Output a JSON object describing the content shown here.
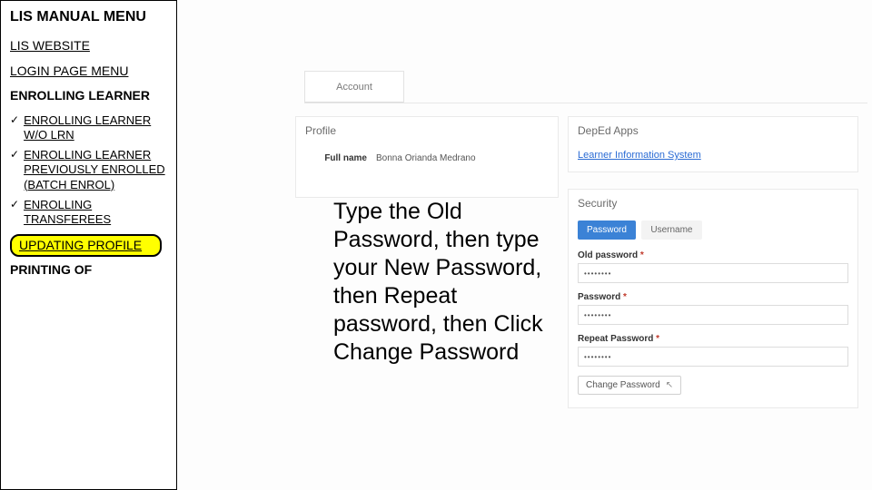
{
  "sidebar": {
    "title": "LIS MANUAL MENU",
    "links": {
      "website": "LIS WEBSITE",
      "login": "LOGIN PAGE MENU"
    },
    "section_heading": "ENROLLING LEARNER",
    "items": [
      "ENROLLING LEARNER W/O LRN",
      "ENROLLING LEARNER PREVIOUSLY ENROLLED (BATCH ENROL)",
      "ENROLLING TRANSFEREES"
    ],
    "highlighted": "UPDATING PROFILE",
    "cutoff": "PRINTING OF"
  },
  "mock": {
    "tab": "Account",
    "profile": {
      "title": "Profile",
      "full_name_label": "Full name",
      "full_name_value": "Bonna Orianda Medrano"
    },
    "apps": {
      "title": "DepEd Apps",
      "link": "Learner Information System"
    },
    "security": {
      "title": "Security",
      "tab_password": "Password",
      "tab_username": "Username",
      "old_pw_label": "Old password ",
      "new_pw_label": "Password ",
      "rep_pw_label": "Repeat Password ",
      "req": "*",
      "dots": "••••••••",
      "change_btn": "Change Password"
    }
  },
  "instruction": "Type the Old Password, then type your New Password, then Repeat password, then Click Change Password"
}
